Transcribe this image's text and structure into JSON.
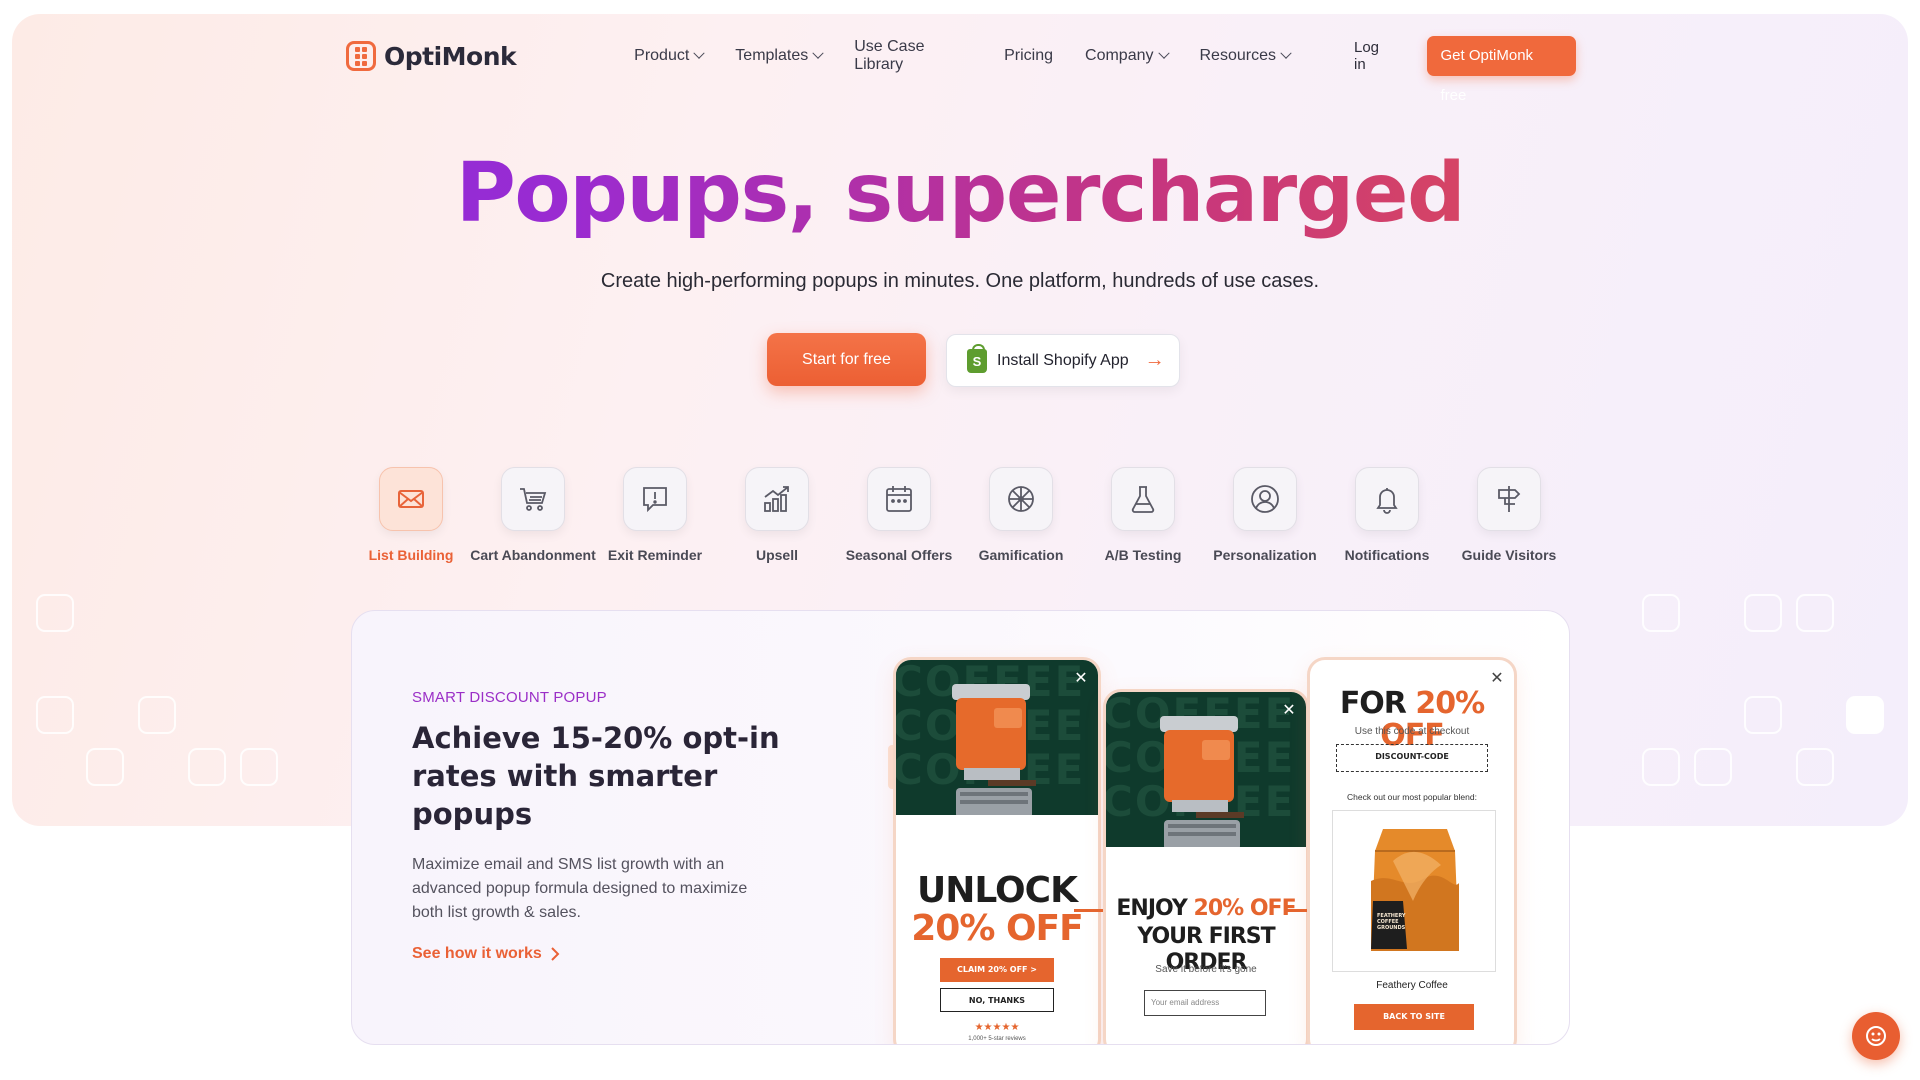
{
  "brand": {
    "name": "OptiMonk",
    "accent": "#f0693c",
    "purple": "#7a2ee8"
  },
  "nav": {
    "items": [
      {
        "label": "Product",
        "dropdown": true
      },
      {
        "label": "Templates",
        "dropdown": true
      },
      {
        "label": "Use Case Library",
        "dropdown": false
      },
      {
        "label": "Pricing",
        "dropdown": false
      },
      {
        "label": "Company",
        "dropdown": true
      },
      {
        "label": "Resources",
        "dropdown": true
      }
    ],
    "login": "Log in",
    "cta": "Get OptiMonk free"
  },
  "hero": {
    "title": "Popups, supercharged",
    "subtitle": "Create high-performing popups in minutes. One platform, hundreds of use cases.",
    "primary_button": "Start for free",
    "secondary_button": "Install Shopify App"
  },
  "categories": [
    {
      "label": "List Building",
      "icon": "envelope-icon",
      "active": true
    },
    {
      "label": "Cart Abandonment",
      "icon": "cart-icon",
      "active": false
    },
    {
      "label": "Exit Reminder",
      "icon": "exit-alert-icon",
      "active": false
    },
    {
      "label": "Upsell",
      "icon": "growth-chart-icon",
      "active": false
    },
    {
      "label": "Seasonal Offers",
      "icon": "calendar-icon",
      "active": false
    },
    {
      "label": "Gamification",
      "icon": "spin-wheel-icon",
      "active": false
    },
    {
      "label": "A/B Testing",
      "icon": "flask-icon",
      "active": false
    },
    {
      "label": "Personalization",
      "icon": "user-circle-icon",
      "active": false
    },
    {
      "label": "Notifications",
      "icon": "bell-icon",
      "active": false
    },
    {
      "label": "Guide Visitors",
      "icon": "signpost-icon",
      "active": false
    }
  ],
  "feature": {
    "kicker": "SMART DISCOUNT POPUP",
    "title": "Achieve 15-20% opt-in rates with smarter popups",
    "body": "Maximize email and SMS list growth with an advanced popup formula designed to maximize both list growth & sales.",
    "link": "See how it works"
  },
  "popups": {
    "p1": {
      "bg_word": "COFFEE",
      "line1": "UNLOCK",
      "line2": "20% OFF",
      "claim": "CLAIM 20% OFF >",
      "decline": "NO, THANKS",
      "stars": "★★★★★",
      "reviews": "1,000+ 5-star reviews"
    },
    "p2": {
      "bg_word": "COFFEE",
      "line1a": "ENJOY ",
      "line1b": "20% OFF",
      "line2": "YOUR FIRST ORDER",
      "note": "Save it before it's gone",
      "email_placeholder": "Your email address"
    },
    "p3": {
      "line1a": "FOR ",
      "line1b": "20% OFF",
      "note": "Use this code at checkout",
      "code": "DISCOUNT-CODE",
      "blend": "Check out our most popular blend:",
      "bag_text": "FEATHERY COFFEE GROUNDS",
      "product": "Feathery Coffee",
      "back": "BACK TO SITE"
    }
  }
}
